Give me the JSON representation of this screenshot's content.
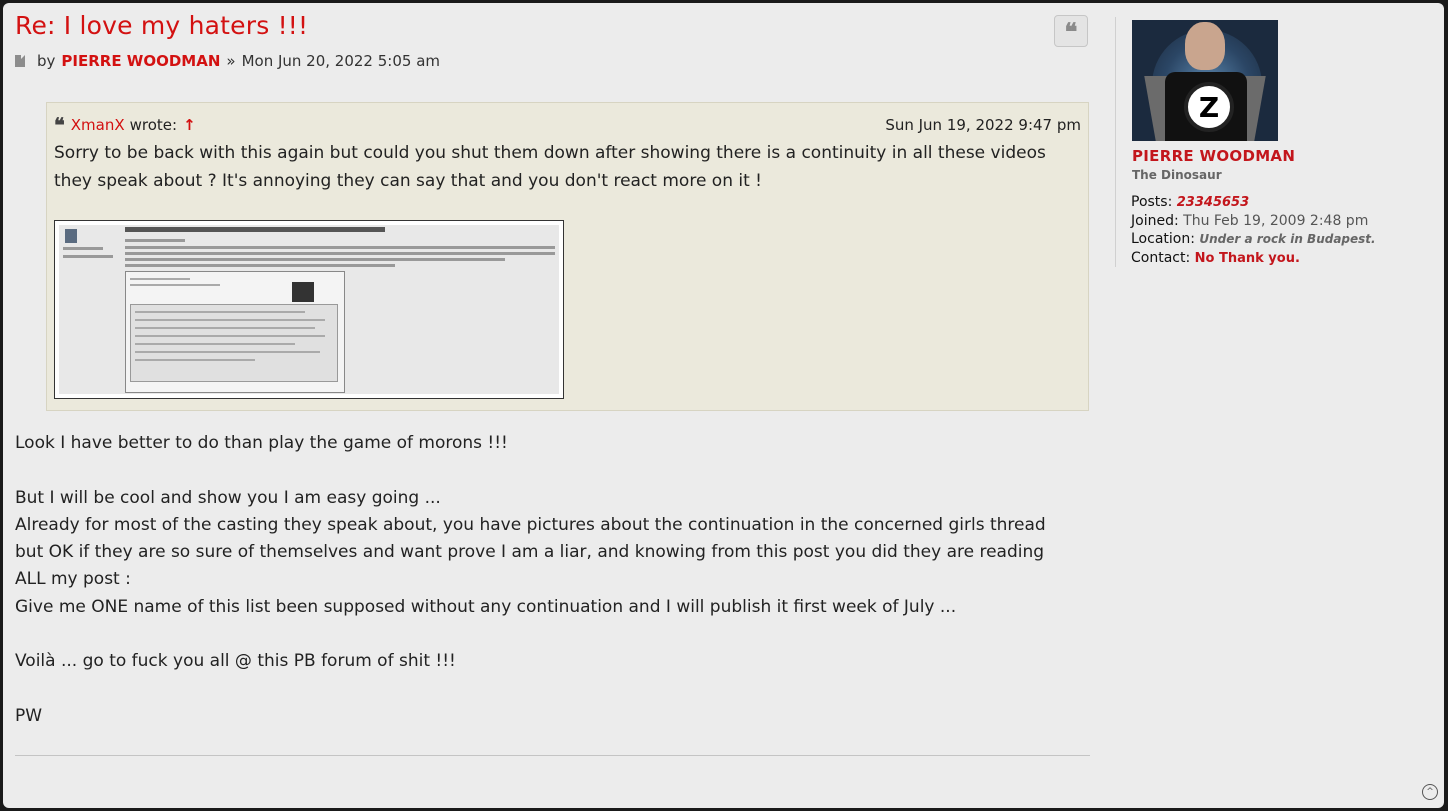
{
  "post": {
    "title": "Re: I love my haters !!!",
    "by_label": "by",
    "author": "PIERRE WOODMAN",
    "separator": "»",
    "datetime": "Mon Jun 20, 2022 5:05 am"
  },
  "quote": {
    "icon": "quote-icon",
    "author": "XmanX",
    "wrote_label": "wrote:",
    "arrow": "↑",
    "datetime": "Sun Jun 19, 2022 9:47 pm",
    "text": "Sorry to be back with this again but could you shut them down after showing there is a continuity in all these videos they speak about ? It's annoying they can say that and you don't react more on it !"
  },
  "body": {
    "lines": [
      "Look I have better to do than play the game of morons !!!",
      "",
      "But I will be cool and show you I am easy going ...",
      "Already for most of the casting they speak about, you have pictures about the continuation in the concerned girls thread",
      "but OK if they are so sure of themselves and want prove I am a liar, and knowing from this post you did they are reading",
      "ALL my post :",
      "Give me ONE name of this list been supposed without any continuation and I will publish it first week of July ...",
      "",
      "Voilà ... go to fuck you all @ this PB forum of shit !!!",
      "",
      "PW"
    ]
  },
  "profile": {
    "name": "PIERRE WOODMAN",
    "rank": "The Dinosaur",
    "posts_label": "Posts:",
    "posts_value": "23345653",
    "joined_label": "Joined:",
    "joined_value": "Thu Feb 19, 2009 2:48 pm",
    "location_label": "Location:",
    "location_value": "Under a rock in Budapest.",
    "contact_label": "Contact:",
    "contact_value": "No Thank you.",
    "avatar_letter": "Z"
  },
  "ui": {
    "quote_button_glyph": "❝",
    "top_button_glyph": "^",
    "colors": {
      "accent": "#d31111",
      "quote_bg": "#ebe9dc",
      "panel_bg": "#ececec"
    }
  }
}
